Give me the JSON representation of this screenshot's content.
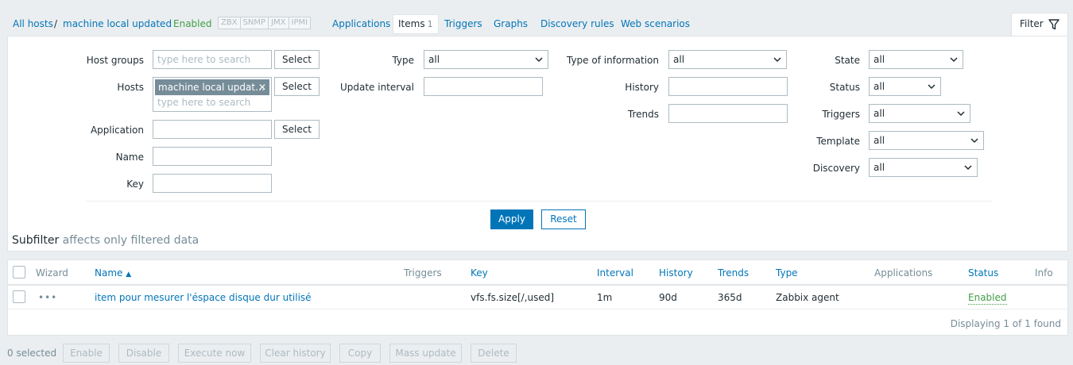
{
  "nav": {
    "all_hosts": "All hosts",
    "separator": "/",
    "host_name": "machine local updated",
    "host_status": "Enabled",
    "protocols": [
      "ZBX",
      "SNMP",
      "JMX",
      "IPMI"
    ],
    "applications": "Applications",
    "items": "Items",
    "items_count": "1",
    "triggers": "Triggers",
    "graphs": "Graphs",
    "discovery_rules": "Discovery rules",
    "web_scenarios": "Web scenarios",
    "filter": "Filter"
  },
  "filter": {
    "host_groups_label": "Host groups",
    "host_groups_placeholder": "type here to search",
    "select_label": "Select",
    "hosts_label": "Hosts",
    "hosts_chip": "machine local updat…",
    "hosts_placeholder": "type here to search",
    "application_label": "Application",
    "name_label": "Name",
    "key_label": "Key",
    "type_label": "Type",
    "type_value": "all",
    "update_interval_label": "Update interval",
    "type_of_information_label": "Type of information",
    "type_of_information_value": "all",
    "history_label": "History",
    "trends_label": "Trends",
    "state_label": "State",
    "state_value": "all",
    "status_label": "Status",
    "status_value": "all",
    "triggers_label": "Triggers",
    "triggers_value": "all",
    "template_label": "Template",
    "template_value": "all",
    "discovery_label": "Discovery",
    "discovery_value": "all",
    "apply": "Apply",
    "reset": "Reset",
    "subfilter": "Subfilter",
    "subfilter_note": "affects only filtered data"
  },
  "table": {
    "headers": {
      "wizard": "Wizard",
      "name": "Name",
      "triggers": "Triggers",
      "key": "Key",
      "interval": "Interval",
      "history": "History",
      "trends": "Trends",
      "type": "Type",
      "applications": "Applications",
      "status": "Status",
      "info": "Info"
    },
    "rows": [
      {
        "wizard": "•••",
        "name": "item pour mesurer l'éspace disque dur utilisé",
        "key": "vfs.fs.size[/,used]",
        "interval": "1m",
        "history": "90d",
        "trends": "365d",
        "type": "Zabbix agent",
        "status": "Enabled"
      }
    ],
    "footer": "Displaying 1 of 1 found"
  },
  "actions": {
    "selected": "0 selected",
    "enable": "Enable",
    "disable": "Disable",
    "execute_now": "Execute now",
    "clear_history": "Clear history",
    "copy": "Copy",
    "mass_update": "Mass update",
    "delete": "Delete"
  },
  "colors": {
    "link": "#0275b8",
    "enabled": "#429e47",
    "background": "#ebeef0"
  }
}
